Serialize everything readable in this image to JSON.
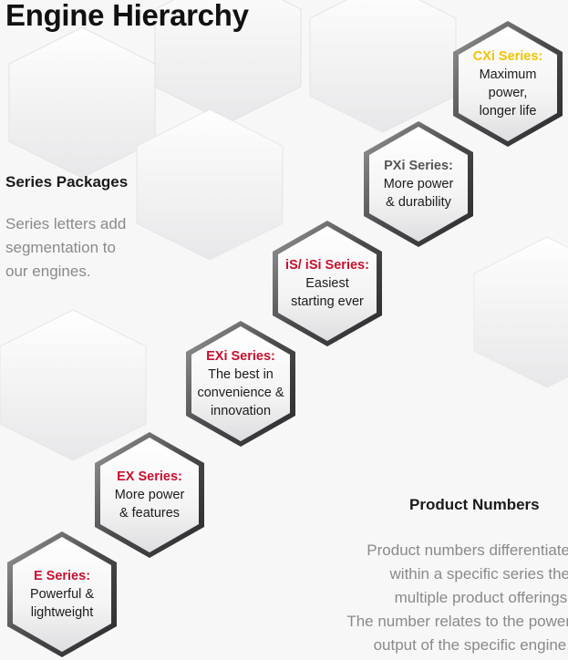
{
  "title": "Engine Hierarchy",
  "series_packages": {
    "heading": "Series Packages",
    "text_lines": [
      "Series letters add",
      "segmentation to",
      "our engines."
    ]
  },
  "product_numbers": {
    "heading": "Product Numbers",
    "text_lines": [
      "Product numbers differentiate",
      "within a specific series the",
      "multiple product offerings.",
      "The number relates to the power",
      "output of the specific engine."
    ]
  },
  "colors": {
    "accent_red": "#c8102e",
    "accent_yellow": "#f2c300"
  },
  "hexagons": [
    {
      "id": "e",
      "title": "E Series:",
      "color": "red",
      "lines": [
        "Powerful &",
        "lightweight"
      ]
    },
    {
      "id": "ex",
      "title": "EX Series:",
      "color": "red",
      "lines": [
        "More power",
        "& features"
      ]
    },
    {
      "id": "exi",
      "title": "EXi Series:",
      "color": "red",
      "lines": [
        "The best in",
        "convenience &",
        "innovation"
      ]
    },
    {
      "id": "isi",
      "title": "iS/ iSi Series:",
      "color": "red",
      "lines": [
        "Easiest",
        "starting ever"
      ]
    },
    {
      "id": "pxi",
      "title": "PXi Series:",
      "color": "gray",
      "lines": [
        "More power",
        "& durability"
      ]
    },
    {
      "id": "cxi",
      "title": "CXi Series:",
      "color": "yellow",
      "lines": [
        "Maximum",
        "power,",
        "longer life"
      ]
    }
  ]
}
